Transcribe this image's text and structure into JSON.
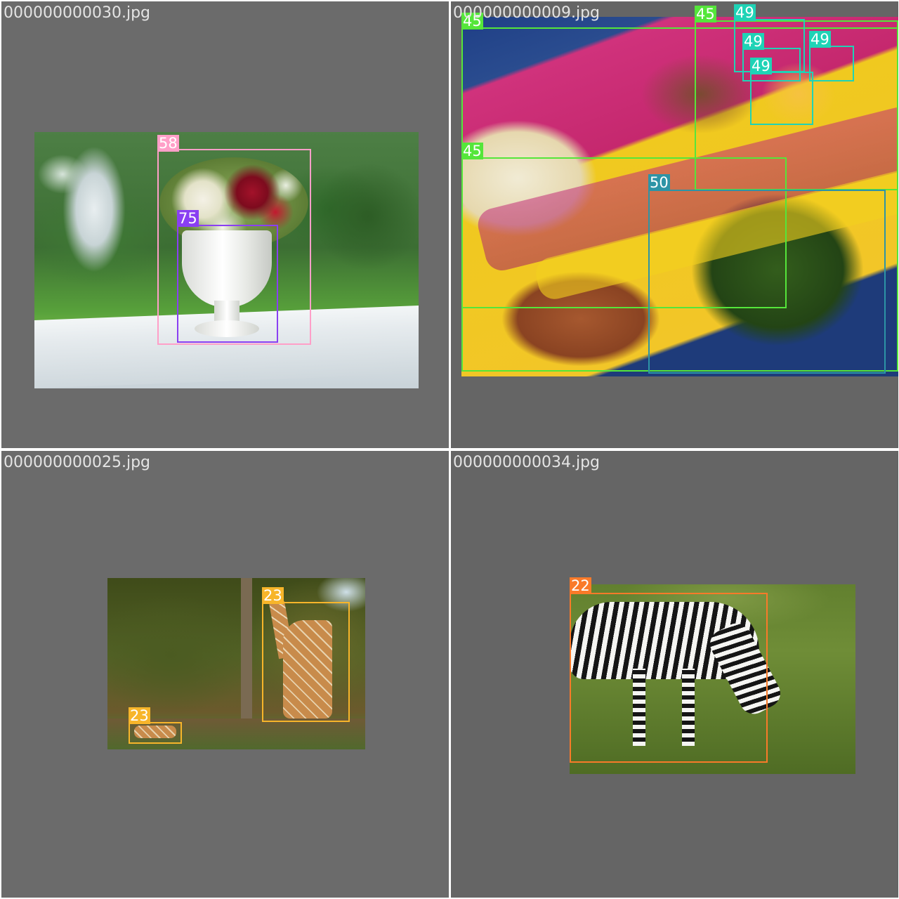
{
  "mosaic": {
    "panels": [
      {
        "filename": "000000000030.jpg",
        "boxes": [
          {
            "label": "58",
            "color": "#ff9fc8"
          },
          {
            "label": "75",
            "color": "#8a3ff2"
          }
        ]
      },
      {
        "filename": "000000000009.jpg",
        "boxes": [
          {
            "label": "45",
            "color": "#55e63a"
          },
          {
            "label": "45",
            "color": "#55e63a"
          },
          {
            "label": "45",
            "color": "#55e63a"
          },
          {
            "label": "49",
            "color": "#1fd3b6"
          },
          {
            "label": "49",
            "color": "#1fd3b6"
          },
          {
            "label": "49",
            "color": "#1fd3b6"
          },
          {
            "label": "49",
            "color": "#1fd3b6"
          },
          {
            "label": "50",
            "color": "#2d94a6"
          }
        ]
      },
      {
        "filename": "000000000025.jpg",
        "boxes": [
          {
            "label": "23",
            "color": "#f7b52a"
          },
          {
            "label": "23",
            "color": "#f7b52a"
          }
        ]
      },
      {
        "filename": "000000000034.jpg",
        "boxes": [
          {
            "label": "22",
            "color": "#f97a29"
          }
        ]
      }
    ]
  }
}
